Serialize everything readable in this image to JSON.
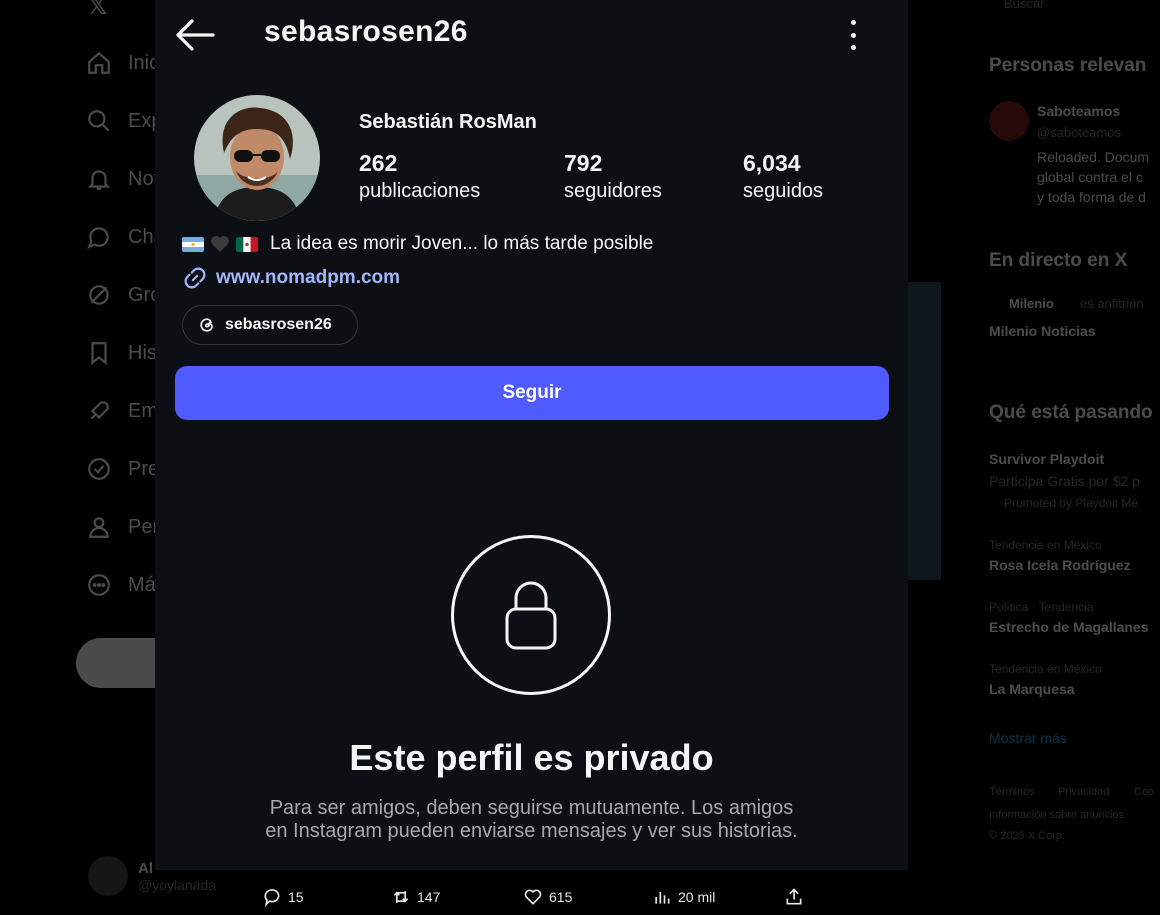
{
  "background": {
    "nav_items": [
      {
        "label": "Inicio",
        "icon": "home-icon"
      },
      {
        "label": "Explorar",
        "icon": "search-icon"
      },
      {
        "label": "Notificaciones",
        "icon": "bell-icon"
      },
      {
        "label": "Chat",
        "icon": "chat-icon"
      },
      {
        "label": "Grok",
        "icon": "grok-icon"
      },
      {
        "label": "Historial",
        "icon": "bookmark-icon"
      },
      {
        "label": "Empleos",
        "icon": "rocket-icon"
      },
      {
        "label": "Premium",
        "icon": "verified-icon"
      },
      {
        "label": "Perfil",
        "icon": "person-icon"
      },
      {
        "label": "Más",
        "icon": "more-circle-icon"
      }
    ],
    "account": {
      "name": "Al",
      "handle": "@yoylanada"
    },
    "search_placeholder": "Buscar",
    "relevant_people": {
      "title": "Personas relevan",
      "name": "Saboteamos",
      "handle": "@saboteamos",
      "bio_lines": [
        "Reloaded. Docum",
        "global contra el c",
        "y toda forma de d"
      ]
    },
    "live": {
      "title": "En directo en X",
      "host": "Milenio",
      "host_suffix": "es anfitrión",
      "show": "Milenio Noticias"
    },
    "trends": {
      "title": "Qué está pasando",
      "items": [
        {
          "context": "",
          "name": "Survivor Playdoit",
          "sub": "Participa Gratis por $2 p",
          "extra": "Promoted by Playdoit Mé"
        },
        {
          "context": "Tendencia en México",
          "name": "Rosa Icela Rodríguez"
        },
        {
          "context": "Política · Tendencia",
          "name": "Estrecho de Magallanes"
        },
        {
          "context": "Tendencia en México",
          "name": "La Marquesa"
        }
      ],
      "show_more": "Mostrar más"
    },
    "footer": [
      "Términos",
      "Privacidad",
      "Coo",
      "Información sobre anuncios",
      "© 2025 X Corp."
    ]
  },
  "modal": {
    "username": "sebasrosen26",
    "full_name": "Sebastián RosMan",
    "stats": [
      {
        "value": "262",
        "label": "publicaciones"
      },
      {
        "value": "792",
        "label": "seguidores"
      },
      {
        "value": "6,034",
        "label": "seguidos"
      }
    ],
    "bio_text": "La idea es morir Joven... lo más tarde posible",
    "bio_prefix_emojis": [
      "flag-argentina",
      "black-heart",
      "flag-mexico"
    ],
    "website": "www.nomadpm.com",
    "threads_handle": "sebasrosen26",
    "follow_label": "Seguir",
    "private_title": "Este perfil es privado",
    "private_desc": "Para ser amigos, deben seguirse mutuamente. Los amigos en Instagram pueden enviarse mensajes y ver sus historias.",
    "colors": {
      "follow_button": "#4f5bff",
      "link": "#a5b4fc",
      "background": "#0c1014"
    }
  },
  "actions": {
    "replies": "15",
    "reposts": "147",
    "likes": "615",
    "views": "20 mil"
  }
}
